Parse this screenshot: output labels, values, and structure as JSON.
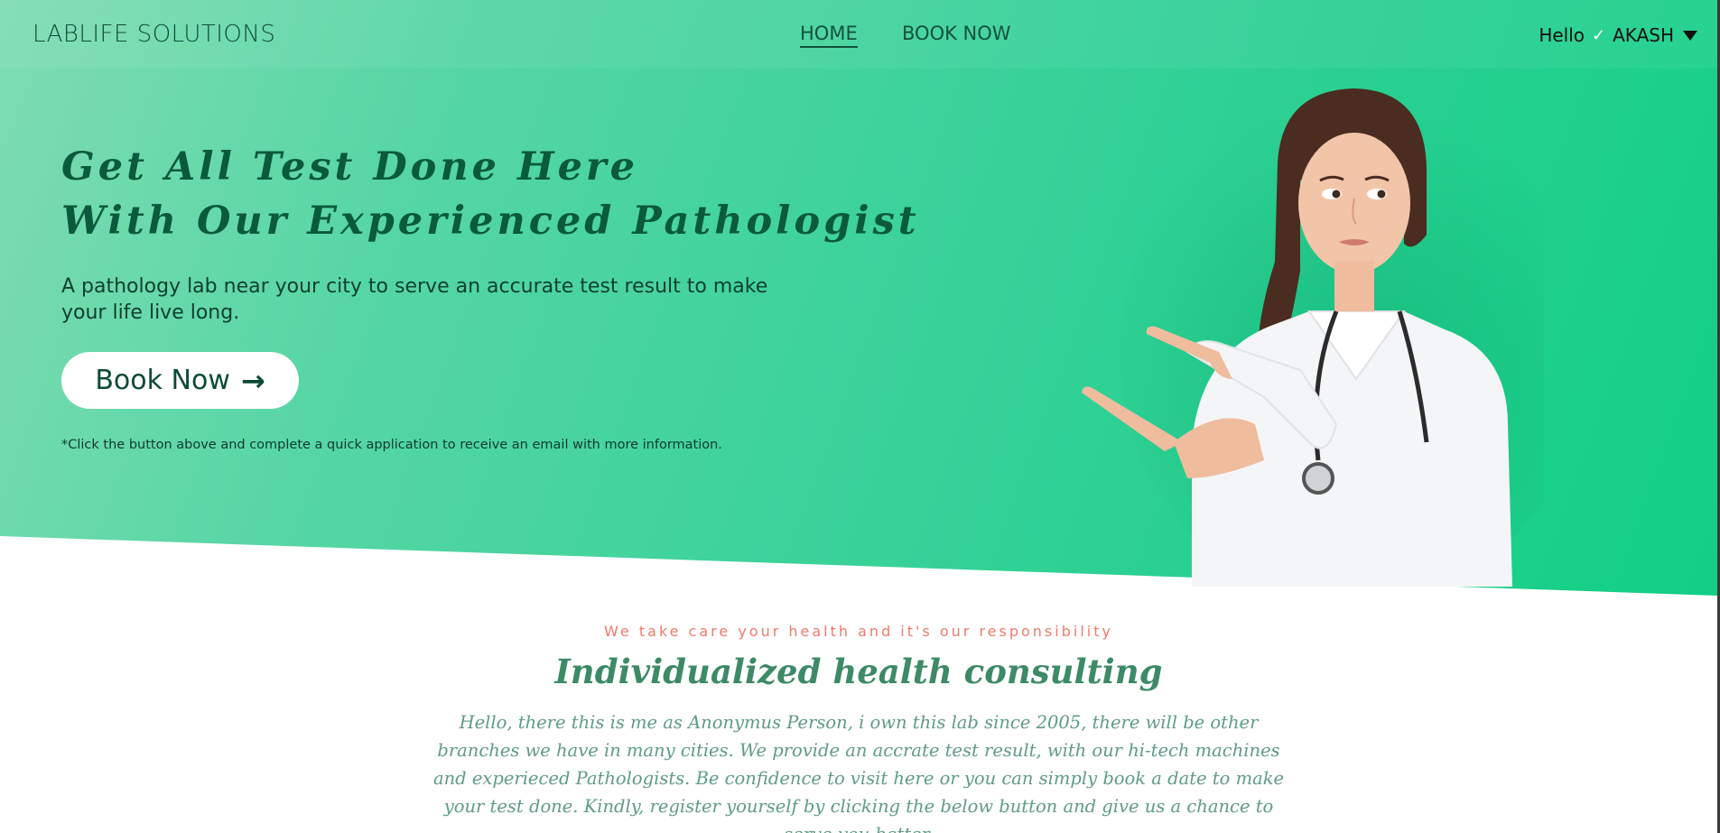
{
  "nav": {
    "brand": "LABLIFE SOLUTIONS",
    "links": [
      {
        "label": "HOME",
        "active": true
      },
      {
        "label": "BOOK NOW",
        "active": false
      }
    ],
    "greeting": "Hello",
    "check_icon": "✓",
    "user_name": "AKASH"
  },
  "hero": {
    "headline_line1": "Get All Test Done Here",
    "headline_line2": "With Our Experienced Pathologist",
    "subtext": "A pathology lab near your city to serve an accurate test result to make your life live long.",
    "button_label": "Book Now",
    "button_arrow": "→",
    "note": "*Click the button above and complete a quick application to receive an email with more information."
  },
  "section": {
    "tagline": "We take care your health and it's our responsibility",
    "title": "Individualized health consulting",
    "body": "Hello, there this is me as Anonymus Person, i own this lab since 2005, there will be other branches we have in many cities. We provide an accrate test result, with our hi-tech machines and experieced Pathologists. Be confidence to visit here or you can simply book a date to make your test done. Kindly, register yourself by clicking the below button and give us a chance to serve you better."
  },
  "colors": {
    "hero_gradient_start": "#7fdcb2",
    "hero_gradient_end": "#12cf85",
    "headline": "#0a5a3b",
    "tagline": "#f07a6c",
    "section_title": "#3d8a66"
  },
  "icons": [
    "check-icon",
    "caret-down-icon",
    "arrow-right-icon"
  ]
}
